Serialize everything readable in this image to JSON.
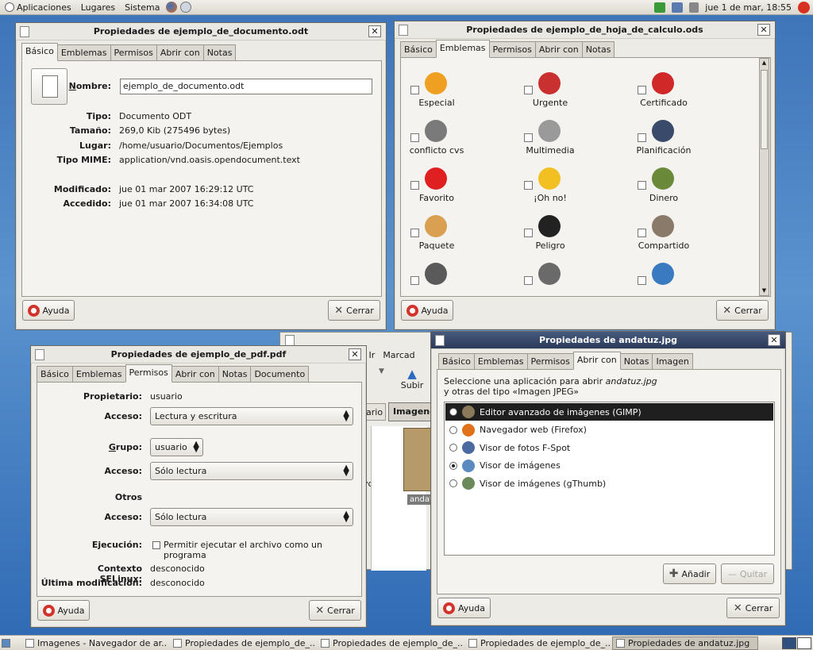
{
  "top_panel": {
    "menu": [
      "Aplicaciones",
      "Lugares",
      "Sistema"
    ],
    "clock": "jue  1 de mar, 18:55"
  },
  "doc_dialog": {
    "title": "Propiedades de ejemplo_de_documento.odt",
    "tabs": [
      "Básico",
      "Emblemas",
      "Permisos",
      "Abrir con",
      "Notas"
    ],
    "name_label": "Nombre:",
    "name_value": "ejemplo_de_documento.odt",
    "rows": [
      {
        "label": "Tipo:",
        "value": "Documento ODT"
      },
      {
        "label": "Tamaño:",
        "value": "269,0 Kib (275496 bytes)"
      },
      {
        "label": "Lugar:",
        "value": "/home/usuario/Documentos/Ejemplos"
      },
      {
        "label": "Tipo MIME:",
        "value": "application/vnd.oasis.opendocument.text"
      },
      {
        "label": "Modificado:",
        "value": "jue 01 mar 2007 16:29:12 UTC"
      },
      {
        "label": "Accedido:",
        "value": "jue 01 mar 2007 16:34:08 UTC"
      }
    ],
    "help": "Ayuda",
    "close": "Cerrar"
  },
  "ods_dialog": {
    "title": "Propiedades de ejemplo_de_hoja_de_calculo.ods",
    "tabs": [
      "Básico",
      "Emblemas",
      "Permisos",
      "Abrir con",
      "Notas"
    ],
    "emblems": [
      {
        "label": "Especial",
        "icon": "star-icon",
        "color": "#f0a020"
      },
      {
        "label": "Urgente",
        "icon": "clock-icon",
        "color": "#c93030"
      },
      {
        "label": "Certificado",
        "icon": "certified-badge-icon",
        "color": "#d02828"
      },
      {
        "label": "conflicto cvs",
        "icon": "cvs-conflict-icon",
        "color": "#7a7a7a"
      },
      {
        "label": "Multimedia",
        "icon": "film-reel-icon",
        "color": "#9a9a9a"
      },
      {
        "label": "Planificación",
        "icon": "chart-icon",
        "color": "#3a4a6a"
      },
      {
        "label": "Favorito",
        "icon": "heart-icon",
        "color": "#e02020"
      },
      {
        "label": "¡Oh no!",
        "icon": "surprised-face-icon",
        "color": "#f2c020"
      },
      {
        "label": "Dinero",
        "icon": "money-icon",
        "color": "#6a8a3a"
      },
      {
        "label": "Paquete",
        "icon": "package-icon",
        "color": "#d8a050"
      },
      {
        "label": "Peligro",
        "icon": "bomb-icon",
        "color": "#222222"
      },
      {
        "label": "Compartido",
        "icon": "shared-hand-icon",
        "color": "#8a7a6a"
      },
      {
        "label": "",
        "icon": "speaker-icon",
        "color": "#5a5a5a"
      },
      {
        "label": "",
        "icon": "read-only-icon",
        "color": "#6a6a6a"
      },
      {
        "label": "",
        "icon": "globe-icon",
        "color": "#3a7ac0"
      }
    ],
    "help": "Ayuda",
    "close": "Cerrar"
  },
  "pdf_dialog": {
    "title": "Propiedades de ejemplo_de_pdf.pdf",
    "tabs": [
      "Básico",
      "Emblemas",
      "Permisos",
      "Abrir con",
      "Notas",
      "Documento"
    ],
    "owner_label": "Propietario:",
    "owner_value": "usuario",
    "access_label": "Acceso:",
    "owner_access": "Lectura y escritura",
    "group_label": "Grupo:",
    "group_value": "usuario",
    "group_access": "Sólo lectura",
    "others_label": "Otros",
    "others_access": "Sólo lectura",
    "exec_label": "Ejecución:",
    "exec_checkbox": "Permitir ejecutar el archivo como un programa",
    "selinux_label": "Contexto SELinux:",
    "selinux_value": "desconocido",
    "lastmod_label": "Última modificación:",
    "lastmod_value": "desconocido",
    "help": "Ayuda",
    "close": "Cerrar"
  },
  "nautilus": {
    "menu_partial": [
      "r",
      "Ir",
      "Marcad"
    ],
    "up_button": "Subir",
    "path_partial": "ario",
    "path_active": "Imagene",
    "side_text": "vos",
    "file_label": "andatu"
  },
  "jpg_dialog": {
    "title": "Propiedades de andatuz.jpg",
    "tabs": [
      "Básico",
      "Emblemas",
      "Permisos",
      "Abrir con",
      "Notas",
      "Imagen"
    ],
    "intro_line1_prefix": "Seleccione una aplicación para abrir ",
    "intro_filename": "andatuz.jpg",
    "intro_line2": "y otras del tipo «Imagen JPEG»",
    "apps": [
      {
        "name": "Editor avanzado de imágenes (GIMP)",
        "icon": "gimp-icon",
        "color": "#8a7a5a"
      },
      {
        "name": "Navegador web (Firefox)",
        "icon": "firefox-icon",
        "color": "#e0701a"
      },
      {
        "name": "Visor de fotos F-Spot",
        "icon": "fspot-icon",
        "color": "#4a6aa0"
      },
      {
        "name": "Visor de imágenes",
        "icon": "image-viewer-icon",
        "color": "#5a8ac0"
      },
      {
        "name": "Visor de imágenes (gThumb)",
        "icon": "gthumb-icon",
        "color": "#6a8a5a"
      }
    ],
    "selected_index": 0,
    "default_index": 3,
    "add": "Añadir",
    "remove": "Quitar",
    "help": "Ayuda",
    "close": "Cerrar"
  },
  "taskbar": [
    {
      "label": "Imagenes - Navegador de ar..."
    },
    {
      "label": "Propiedades de ejemplo_de_..."
    },
    {
      "label": "Propiedades de ejemplo_de_..."
    },
    {
      "label": "Propiedades de ejemplo_de_..."
    },
    {
      "label": "Propiedades de andatuz.jpg"
    }
  ]
}
